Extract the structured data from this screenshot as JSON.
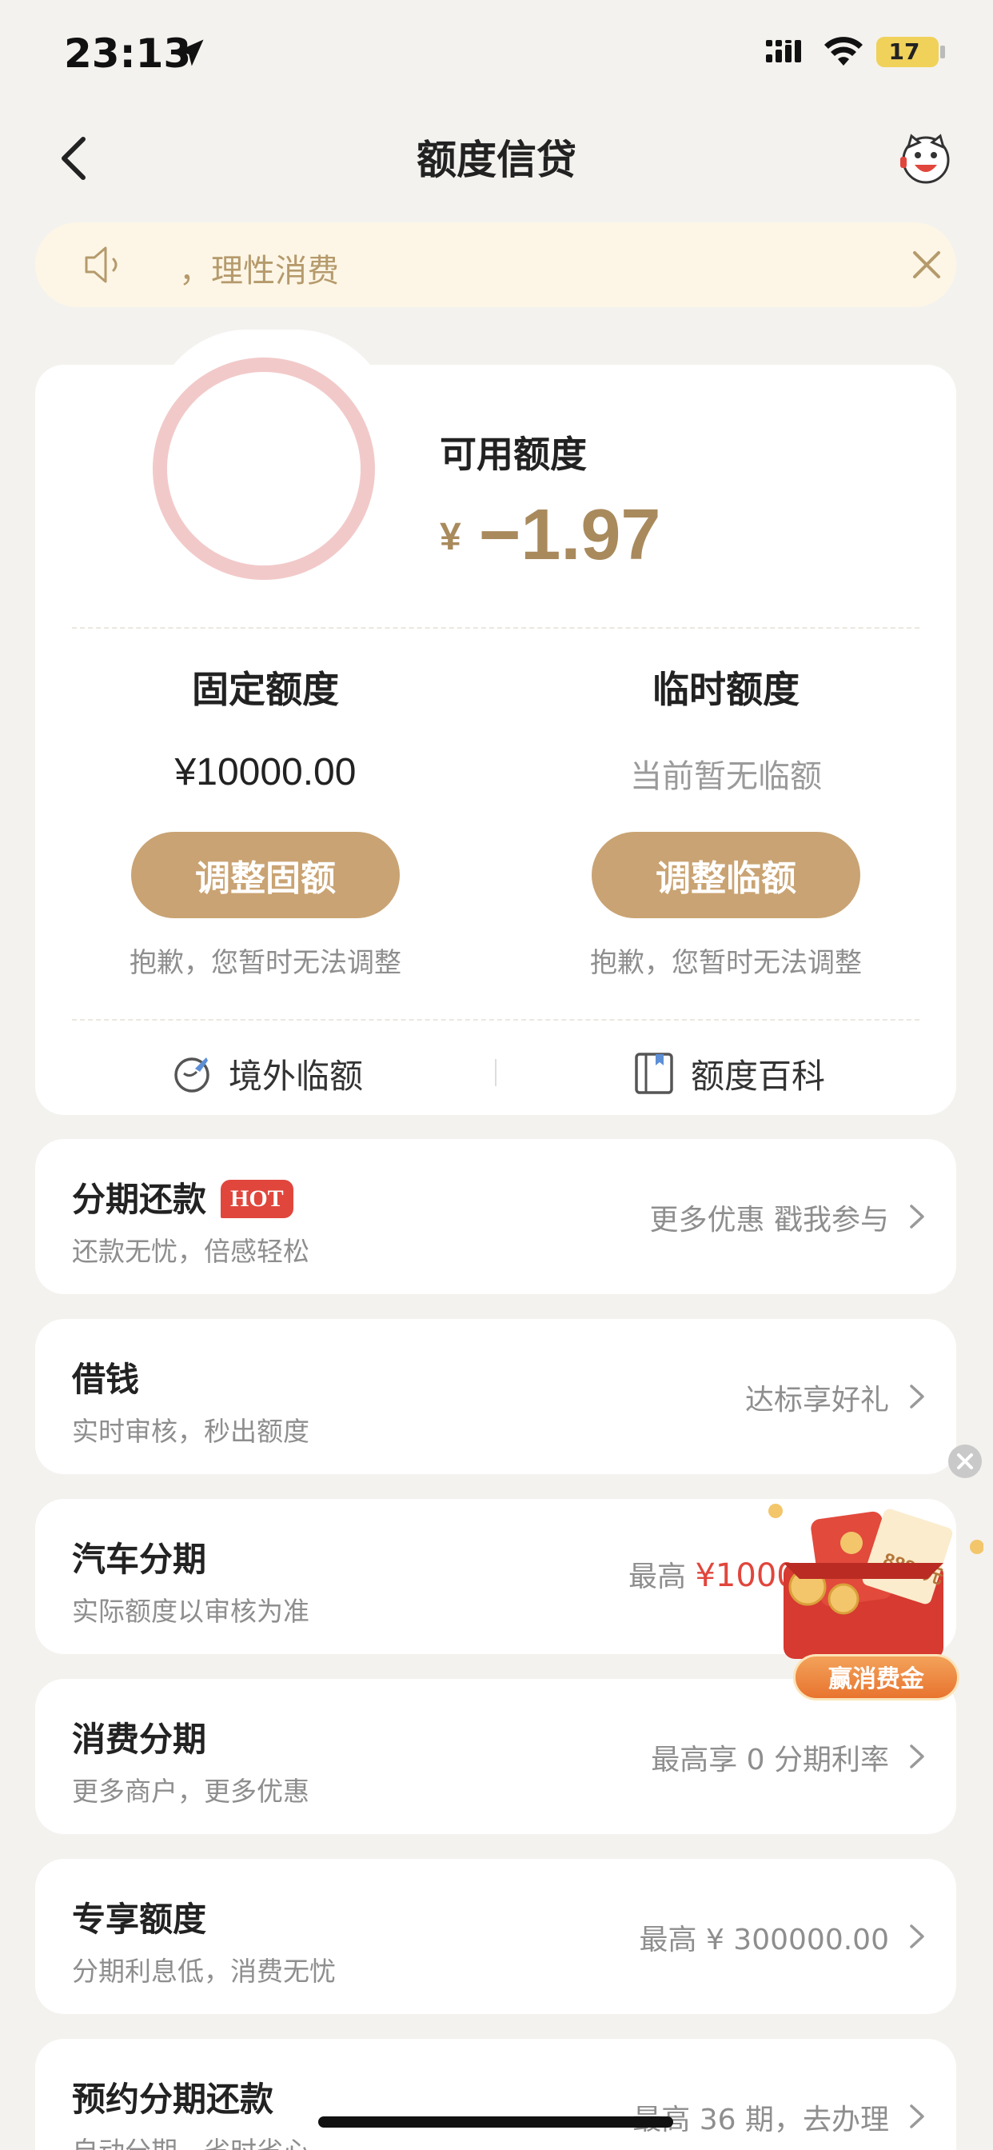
{
  "status_bar": {
    "time": "23:13",
    "battery": "17"
  },
  "nav": {
    "title": "额度信贷"
  },
  "notice": {
    "text": "，理性消费"
  },
  "credit": {
    "available_label": "可用额度",
    "currency_symbol": "¥",
    "available_value": "−1.97",
    "fixed": {
      "title": "固定额度",
      "value": "¥10000.00",
      "button": "调整固额",
      "note": "抱歉，您暂时无法调整"
    },
    "temporary": {
      "title": "临时额度",
      "value": "当前暂无临额",
      "button": "调整临额",
      "note": "抱歉，您暂时无法调整"
    },
    "links": {
      "overseas": "境外临额",
      "encyclopedia": "额度百科"
    }
  },
  "rows": [
    {
      "title": "分期还款",
      "badge": "HOT",
      "subtitle": "还款无忧，倍感轻松",
      "right": "更多优惠 戳我参与"
    },
    {
      "title": "借钱",
      "subtitle": "实时审核，秒出额度",
      "right": "达标享好礼"
    },
    {
      "title": "汽车分期",
      "subtitle": "实际额度以审核为准",
      "right_prefix": "最高",
      "right_highlight": "¥1000"
    },
    {
      "title": "消费分期",
      "subtitle": "更多商户，更多优惠",
      "right": "最高享 0 分期利率"
    },
    {
      "title": "专享额度",
      "subtitle": "分期利息低，消费无忧",
      "right": "最高 ¥ 300000.00"
    },
    {
      "title": "预约分期还款",
      "subtitle": "自动分期，省时省心",
      "right": "最高 36 期，去办理"
    }
  ],
  "promo": {
    "button": "赢消费金",
    "ticket_text": "8888元"
  },
  "colors": {
    "accent_gold": "#c9a373",
    "value_gold": "#a98a5d",
    "hot_red": "#e0463c",
    "ring_pink": "#f2c9c9"
  }
}
